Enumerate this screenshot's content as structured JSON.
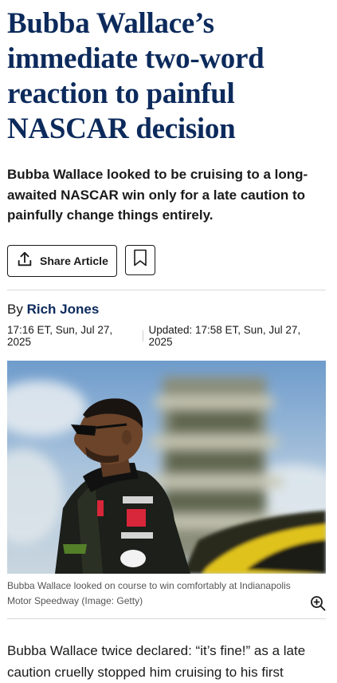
{
  "article": {
    "headline": "Bubba Wallace’s immediate two-word reaction to painful NASCAR decision",
    "standfirst": "Bubba Wallace looked to be cruising to a long-awaited NASCAR win only for a late caution to painfully change things entirely.",
    "share_label": "Share Article",
    "byline_prefix": "By",
    "author": "Rich Jones",
    "published": "17:16 ET, Sun, Jul 27, 2025",
    "updated": "Updated: 17:58 ET, Sun, Jul 27, 2025",
    "image_caption": "Bubba Wallace looked on course to win comfortably at Indianapolis Motor Speedway",
    "image_credit": "(Image: Getty)",
    "body_first": "Bubba Wallace twice declared: “it’s fine!” as a late caution cruelly stopped him cruising to his first"
  },
  "icons": {
    "share": "share-icon",
    "bookmark": "bookmark-icon",
    "zoom": "zoom-in-icon"
  },
  "colors": {
    "headline": "#0c2a5c",
    "author": "#0c2a5c"
  }
}
